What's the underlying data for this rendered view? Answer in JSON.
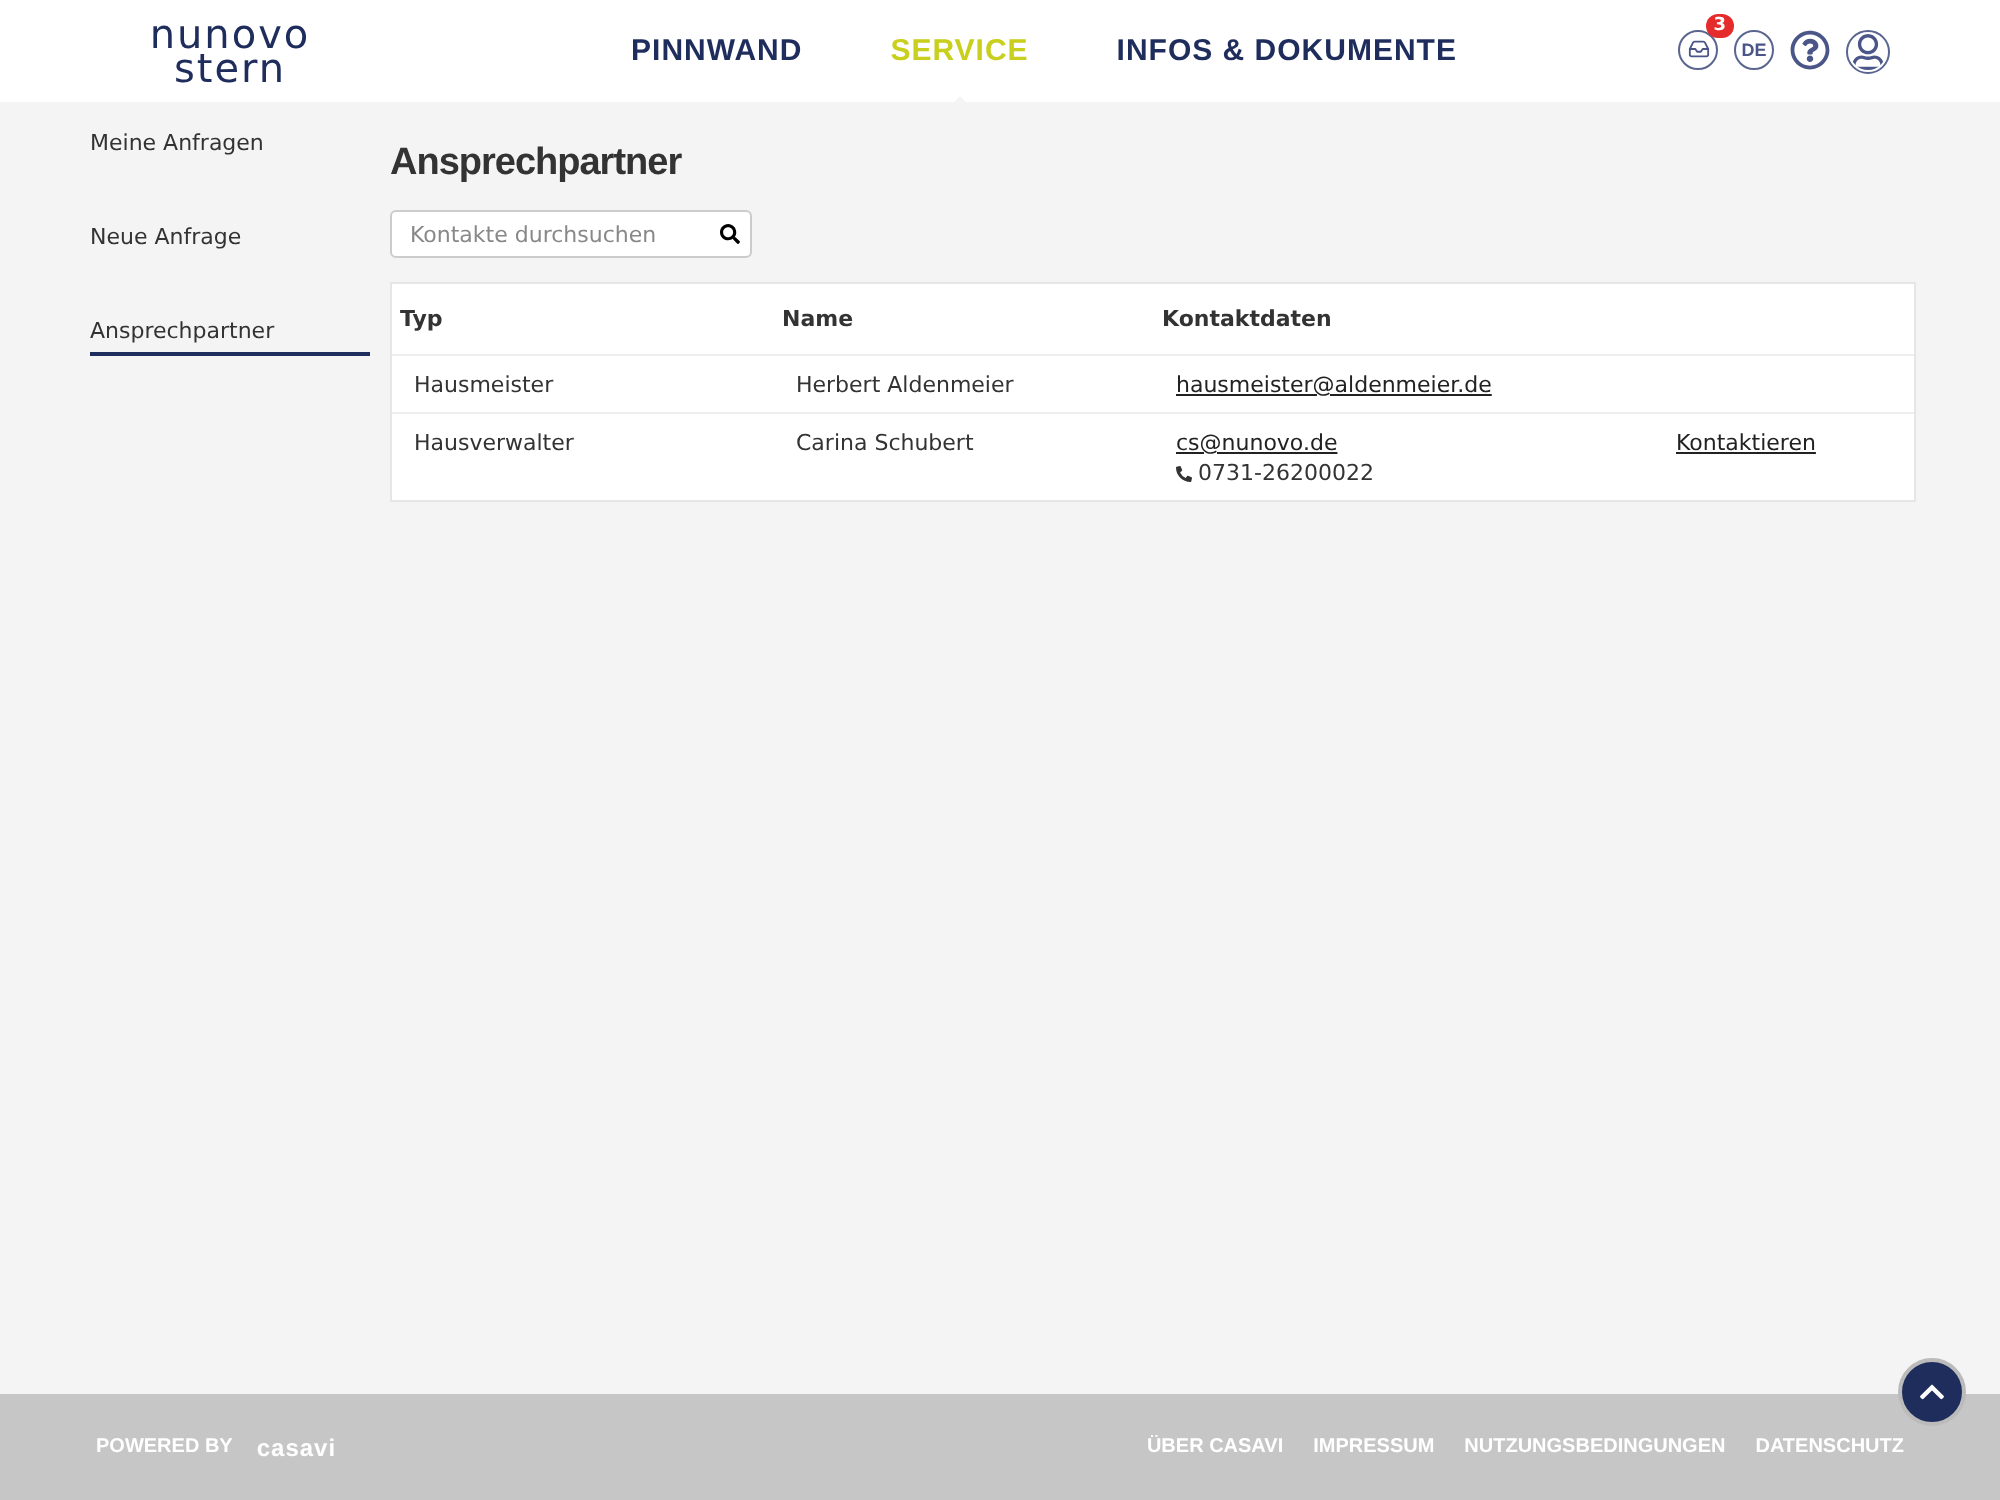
{
  "logo": {
    "line_1": "nunovo",
    "line_2": "stern"
  },
  "nav": [
    {
      "label": "PINNWAND",
      "selected": false
    },
    {
      "label": "SERVICE",
      "selected": true
    },
    {
      "label": "INFOS & DOKUMENTE",
      "selected": false
    }
  ],
  "header_icons": {
    "inbox_badge": "3",
    "language": "DE"
  },
  "sidebar": {
    "items": [
      {
        "label": "Meine Anfragen",
        "selected": false
      },
      {
        "label": "Neue Anfrage",
        "selected": false
      },
      {
        "label": "Ansprechpartner",
        "selected": true
      }
    ]
  },
  "page_title": "Ansprechpartner",
  "search": {
    "placeholder": "Kontakte durchsuchen"
  },
  "table": {
    "columns": [
      "Typ",
      "Name",
      "Kontaktdaten"
    ],
    "rows": [
      {
        "type": "Hausmeister",
        "name": "Herbert Aldenmeier",
        "email": "hausmeister@aldenmeier.de"
      },
      {
        "type": "Hausverwalter",
        "name": "Carina Schubert",
        "email": "cs@nunovo.de",
        "phone": "0731-26200022",
        "action": "Kontaktieren"
      }
    ]
  },
  "footer": {
    "powered_by": "POWERED BY",
    "brand": "casavi",
    "links": [
      "ÜBER CASAVI",
      "IMPRESSUM",
      "NUTZUNGSBEDINGUNGEN",
      "DATENSCHUTZ"
    ]
  }
}
